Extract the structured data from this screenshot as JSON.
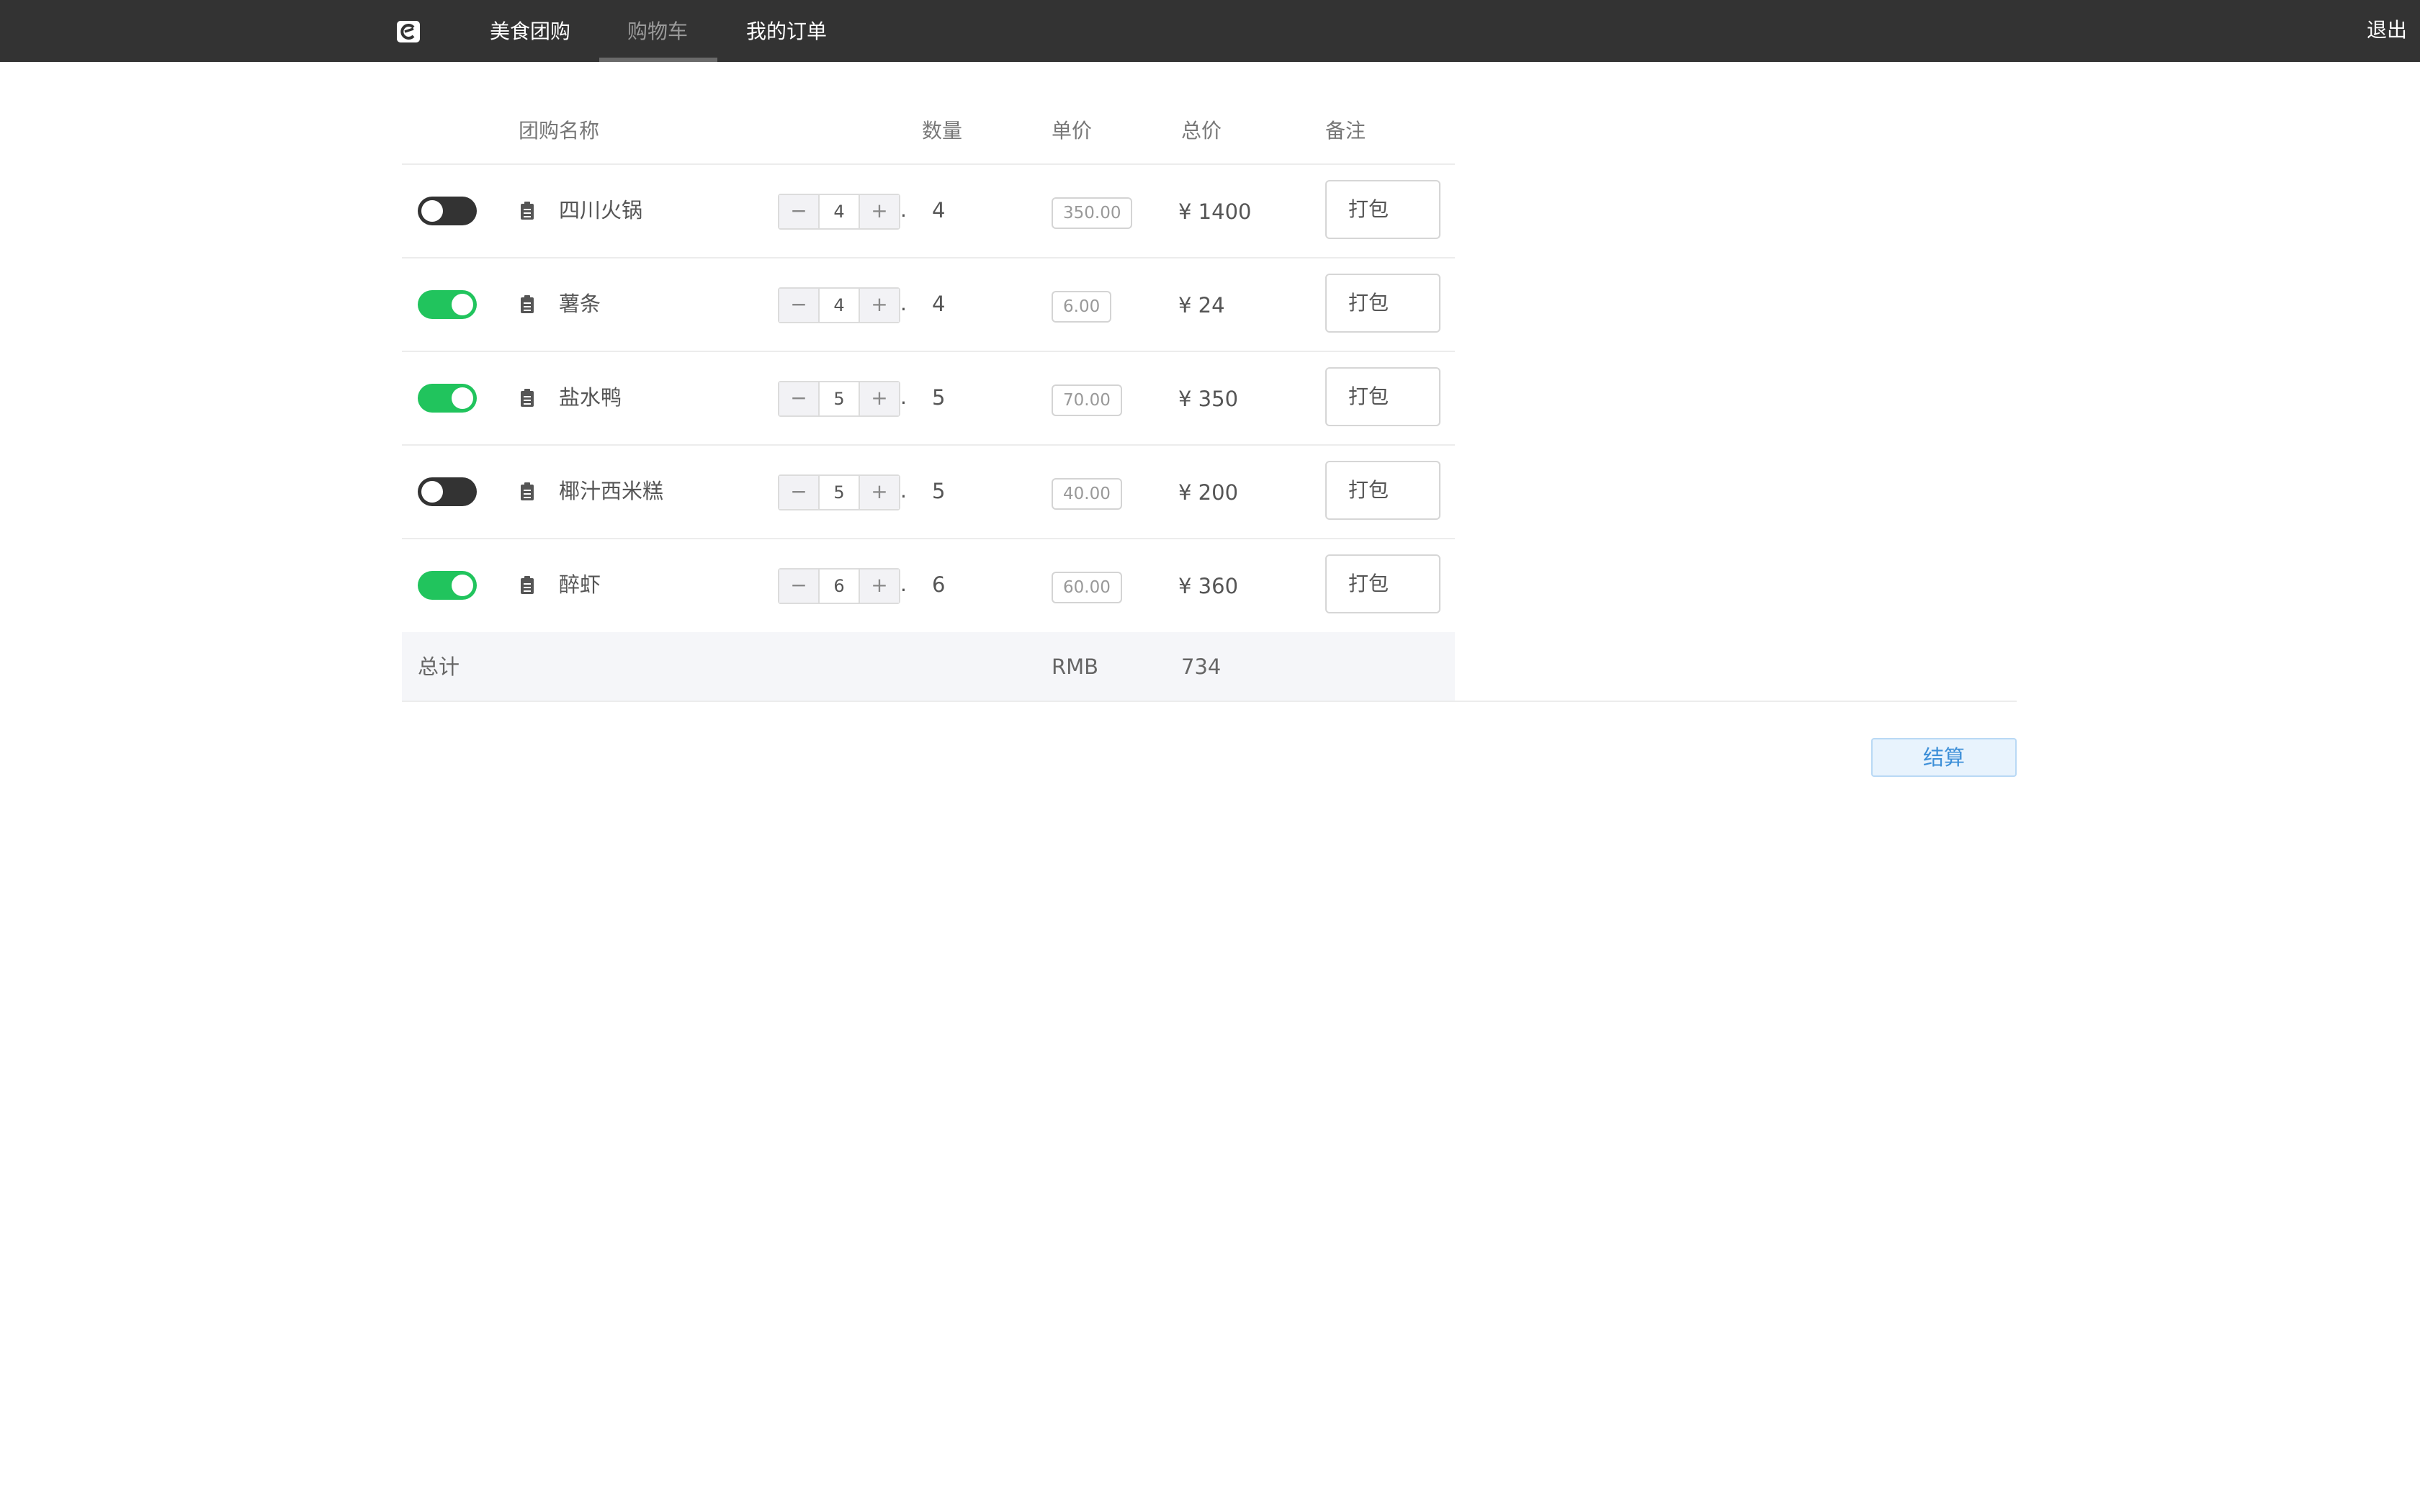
{
  "nav": {
    "items": [
      {
        "label": "美食团购"
      },
      {
        "label": "购物车"
      },
      {
        "label": "我的订单"
      }
    ],
    "active": "购物车",
    "logout_label": "退出"
  },
  "table": {
    "headers": {
      "name": "团购名称",
      "quantity": "数量",
      "unit_price": "单价",
      "total": "总价",
      "note": "备注"
    },
    "rows": [
      {
        "selected": false,
        "name": "四川火锅",
        "stepper_value": "4",
        "quantity": "4",
        "unit_price": "350.00",
        "total": "¥ 1400",
        "note": "打包"
      },
      {
        "selected": true,
        "name": "薯条",
        "stepper_value": "4",
        "quantity": "4",
        "unit_price": "6.00",
        "total": "¥ 24",
        "note": "打包"
      },
      {
        "selected": true,
        "name": "盐水鸭",
        "stepper_value": "5",
        "quantity": "5",
        "unit_price": "70.00",
        "total": "¥ 350",
        "note": "打包"
      },
      {
        "selected": false,
        "name": "椰汁西米糕",
        "stepper_value": "5",
        "quantity": "5",
        "unit_price": "40.00",
        "total": "¥ 200",
        "note": "打包"
      },
      {
        "selected": true,
        "name": "醉虾",
        "stepper_value": "6",
        "quantity": "6",
        "unit_price": "60.00",
        "total": "¥ 360",
        "note": "打包"
      }
    ],
    "summary": {
      "label": "总计",
      "currency": "RMB",
      "value": "734"
    }
  },
  "stepper": {
    "minus": "−",
    "plus": "+",
    "dot": "."
  },
  "checkout_label": "结算",
  "colors": {
    "topbar": "#333333",
    "toggle_on": "#21c45d",
    "toggle_off": "#333333",
    "checkout_text": "#3d8fd8"
  }
}
